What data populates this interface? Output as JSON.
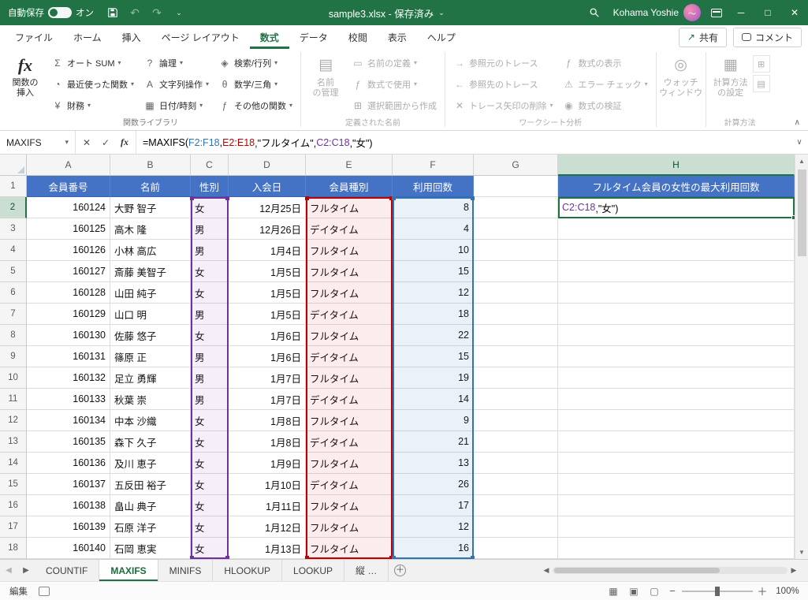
{
  "colors": {
    "excel_green": "#217346",
    "header_blue": "#4472C4",
    "range_blue": "#2E75B6",
    "range_red": "#C00000",
    "range_purple": "#7030A0"
  },
  "titlebar": {
    "autosave_label": "自動保存",
    "autosave_state": "オン",
    "title": "sample3.xlsx - 保存済み",
    "user": "Kohama Yoshie"
  },
  "tabs": {
    "items": [
      "ファイル",
      "ホーム",
      "挿入",
      "ページ レイアウト",
      "数式",
      "データ",
      "校閲",
      "表示",
      "ヘルプ"
    ],
    "active": "数式",
    "share": "共有",
    "comments": "コメント"
  },
  "ribbon": {
    "fn_group": {
      "title": "関数ライブラリ",
      "big_line1": "関数の",
      "big_line2": "挿入",
      "buttons": [
        "オート SUM",
        "最近使った関数",
        "財務",
        "論理",
        "文字列操作",
        "日付/時刻",
        "検索/行列",
        "数学/三角",
        "その他の関数"
      ]
    },
    "names_group": {
      "title": "定義された名前",
      "big_line1": "名前",
      "big_line2": "の管理",
      "buttons": [
        "名前の定義",
        "数式で使用",
        "選択範囲から作成"
      ]
    },
    "audit_group": {
      "title": "ワークシート分析",
      "buttons": [
        "参照元のトレース",
        "参照先のトレース",
        "トレース矢印の削除",
        "数式の表示",
        "エラー チェック",
        "数式の検証"
      ]
    },
    "watch_group": {
      "big_line1": "ウォッチ",
      "big_line2": "ウィンドウ"
    },
    "calc_group": {
      "title": "計算方法",
      "big_line1": "計算方法",
      "big_line2": "の設定"
    }
  },
  "formula_bar": {
    "name_box": "MAXIFS",
    "segments": [
      {
        "t": "=MAXIFS(",
        "c": "#000000"
      },
      {
        "t": "F2:F18",
        "c": "#2E75B6"
      },
      {
        "t": ",",
        "c": "#000000"
      },
      {
        "t": "E2:E18",
        "c": "#C00000"
      },
      {
        "t": ",\"フルタイム\",",
        "c": "#000000"
      },
      {
        "t": "C2:C18",
        "c": "#7030A0"
      },
      {
        "t": ",\"女\")",
        "c": "#000000"
      }
    ]
  },
  "grid": {
    "columns": [
      "A",
      "B",
      "C",
      "D",
      "E",
      "F",
      "G",
      "H"
    ],
    "header_row": [
      "会員番号",
      "名前",
      "性別",
      "入会日",
      "会員種別",
      "利用回数"
    ],
    "h1_label": "フルタイム会員の女性の最大利用回数",
    "rows": [
      [
        "160124",
        "大野 智子",
        "女",
        "12月25日",
        "フルタイム",
        "8"
      ],
      [
        "160125",
        "高木 隆",
        "男",
        "12月26日",
        "デイタイム",
        "4"
      ],
      [
        "160126",
        "小林 高広",
        "男",
        "1月4日",
        "フルタイム",
        "10"
      ],
      [
        "160127",
        "斎藤 美智子",
        "女",
        "1月5日",
        "フルタイム",
        "15"
      ],
      [
        "160128",
        "山田 純子",
        "女",
        "1月5日",
        "フルタイム",
        "12"
      ],
      [
        "160129",
        "山口 明",
        "男",
        "1月5日",
        "デイタイム",
        "18"
      ],
      [
        "160130",
        "佐藤 悠子",
        "女",
        "1月6日",
        "フルタイム",
        "22"
      ],
      [
        "160131",
        "篠原 正",
        "男",
        "1月6日",
        "デイタイム",
        "15"
      ],
      [
        "160132",
        "足立 勇輝",
        "男",
        "1月7日",
        "フルタイム",
        "19"
      ],
      [
        "160133",
        "秋葉 崇",
        "男",
        "1月7日",
        "デイタイム",
        "14"
      ],
      [
        "160134",
        "中本 沙織",
        "女",
        "1月8日",
        "フルタイム",
        "9"
      ],
      [
        "160135",
        "森下 久子",
        "女",
        "1月8日",
        "デイタイム",
        "21"
      ],
      [
        "160136",
        "及川 恵子",
        "女",
        "1月9日",
        "フルタイム",
        "13"
      ],
      [
        "160137",
        "五反田 裕子",
        "女",
        "1月10日",
        "デイタイム",
        "26"
      ],
      [
        "160138",
        "畠山 典子",
        "女",
        "1月11日",
        "フルタイム",
        "17"
      ],
      [
        "160139",
        "石原 洋子",
        "女",
        "1月12日",
        "フルタイム",
        "12"
      ],
      [
        "160140",
        "石岡 恵実",
        "女",
        "1月13日",
        "フルタイム",
        "16"
      ]
    ],
    "h2_segments": [
      {
        "t": "C2:C18",
        "c": "#7030A0"
      },
      {
        "t": ",\"女\")",
        "c": "#000000"
      }
    ]
  },
  "sheet_tabs": {
    "tabs": [
      "COUNTIF",
      "MAXIFS",
      "MINIFS",
      "HLOOKUP",
      "LOOKUP",
      "縦 …"
    ],
    "active": "MAXIFS"
  },
  "status_bar": {
    "mode": "編集",
    "zoom": "100%"
  }
}
